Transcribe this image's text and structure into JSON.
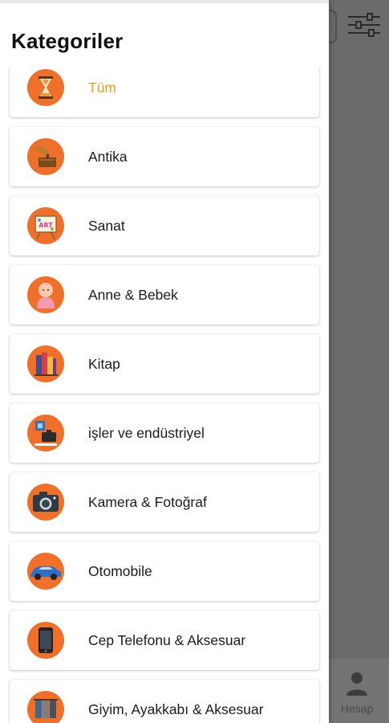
{
  "drawer": {
    "title": "Kategoriler"
  },
  "categories": [
    {
      "label": "Tüm",
      "icon": "hourglass-icon",
      "selected": true
    },
    {
      "label": "Antika",
      "icon": "gramophone-icon",
      "selected": false
    },
    {
      "label": "Sanat",
      "icon": "art-easel-icon",
      "selected": false
    },
    {
      "label": "Anne & Bebek",
      "icon": "baby-icon",
      "selected": false
    },
    {
      "label": "Kitap",
      "icon": "books-icon",
      "selected": false
    },
    {
      "label": "işler ve endüstriyel",
      "icon": "business-icon",
      "selected": false
    },
    {
      "label": "Kamera & Fotoğraf",
      "icon": "camera-icon",
      "selected": false
    },
    {
      "label": "Otomobile",
      "icon": "car-icon",
      "selected": false
    },
    {
      "label": "Cep Telefonu & Aksesuar",
      "icon": "smartphone-icon",
      "selected": false
    },
    {
      "label": "Giyim, Ayakkabı & Aksesuar",
      "icon": "clothing-icon",
      "selected": false
    }
  ],
  "background": {
    "filter_icon": "filter-sliders-icon",
    "account_label": "Hesap",
    "account_icon": "person-icon"
  },
  "colors": {
    "accent": "#f29a1e",
    "icon_circle": "#f0702a",
    "scrim": "#6b6b6b"
  }
}
